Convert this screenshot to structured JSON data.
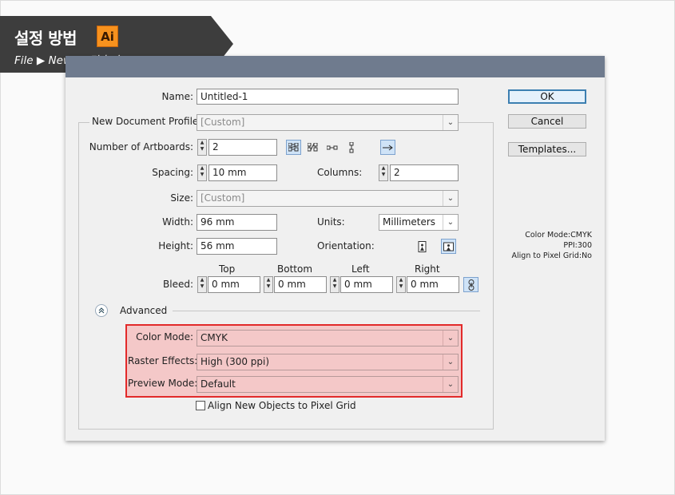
{
  "banner": {
    "title": "설정 방법",
    "logo_text": "Ai",
    "subtitle": "File ▶ New...  (단축키 : Ctrl + N)"
  },
  "dialog": {
    "name_label": "Name:",
    "name_value": "Untitled-1",
    "profile_label": "New Document Profile:",
    "profile_value": "[Custom]",
    "artboards_label": "Number of Artboards:",
    "artboards_value": "2",
    "spacing_label": "Spacing:",
    "spacing_value": "10 mm",
    "columns_label": "Columns:",
    "columns_value": "2",
    "size_label": "Size:",
    "size_value": "[Custom]",
    "width_label": "Width:",
    "width_value": "96 mm",
    "units_label": "Units:",
    "units_value": "Millimeters",
    "height_label": "Height:",
    "height_value": "56 mm",
    "orientation_label": "Orientation:",
    "bleed_label": "Bleed:",
    "bleed": {
      "top_label": "Top",
      "top_value": "0 mm",
      "bottom_label": "Bottom",
      "bottom_value": "0 mm",
      "left_label": "Left",
      "left_value": "0 mm",
      "right_label": "Right",
      "right_value": "0 mm"
    },
    "advanced_label": "Advanced",
    "color_mode_label": "Color Mode:",
    "color_mode_value": "CMYK",
    "raster_label": "Raster Effects:",
    "raster_value": "High (300 ppi)",
    "preview_label": "Preview Mode:",
    "preview_value": "Default",
    "align_label": "Align New Objects to Pixel Grid",
    "align_checked": false,
    "buttons": {
      "ok": "OK",
      "cancel": "Cancel",
      "templates": "Templates..."
    },
    "info": {
      "color_mode": "Color Mode:CMYK",
      "ppi": "PPI:300",
      "align_grid": "Align to Pixel Grid:No"
    }
  },
  "colors": {
    "banner_bg": "#3d3d3d",
    "titlebar": "#6f7b8e",
    "highlight_border": "#e22a2a",
    "highlight_fill": "#f4c8c8",
    "ok_border": "#3c7fb1"
  }
}
